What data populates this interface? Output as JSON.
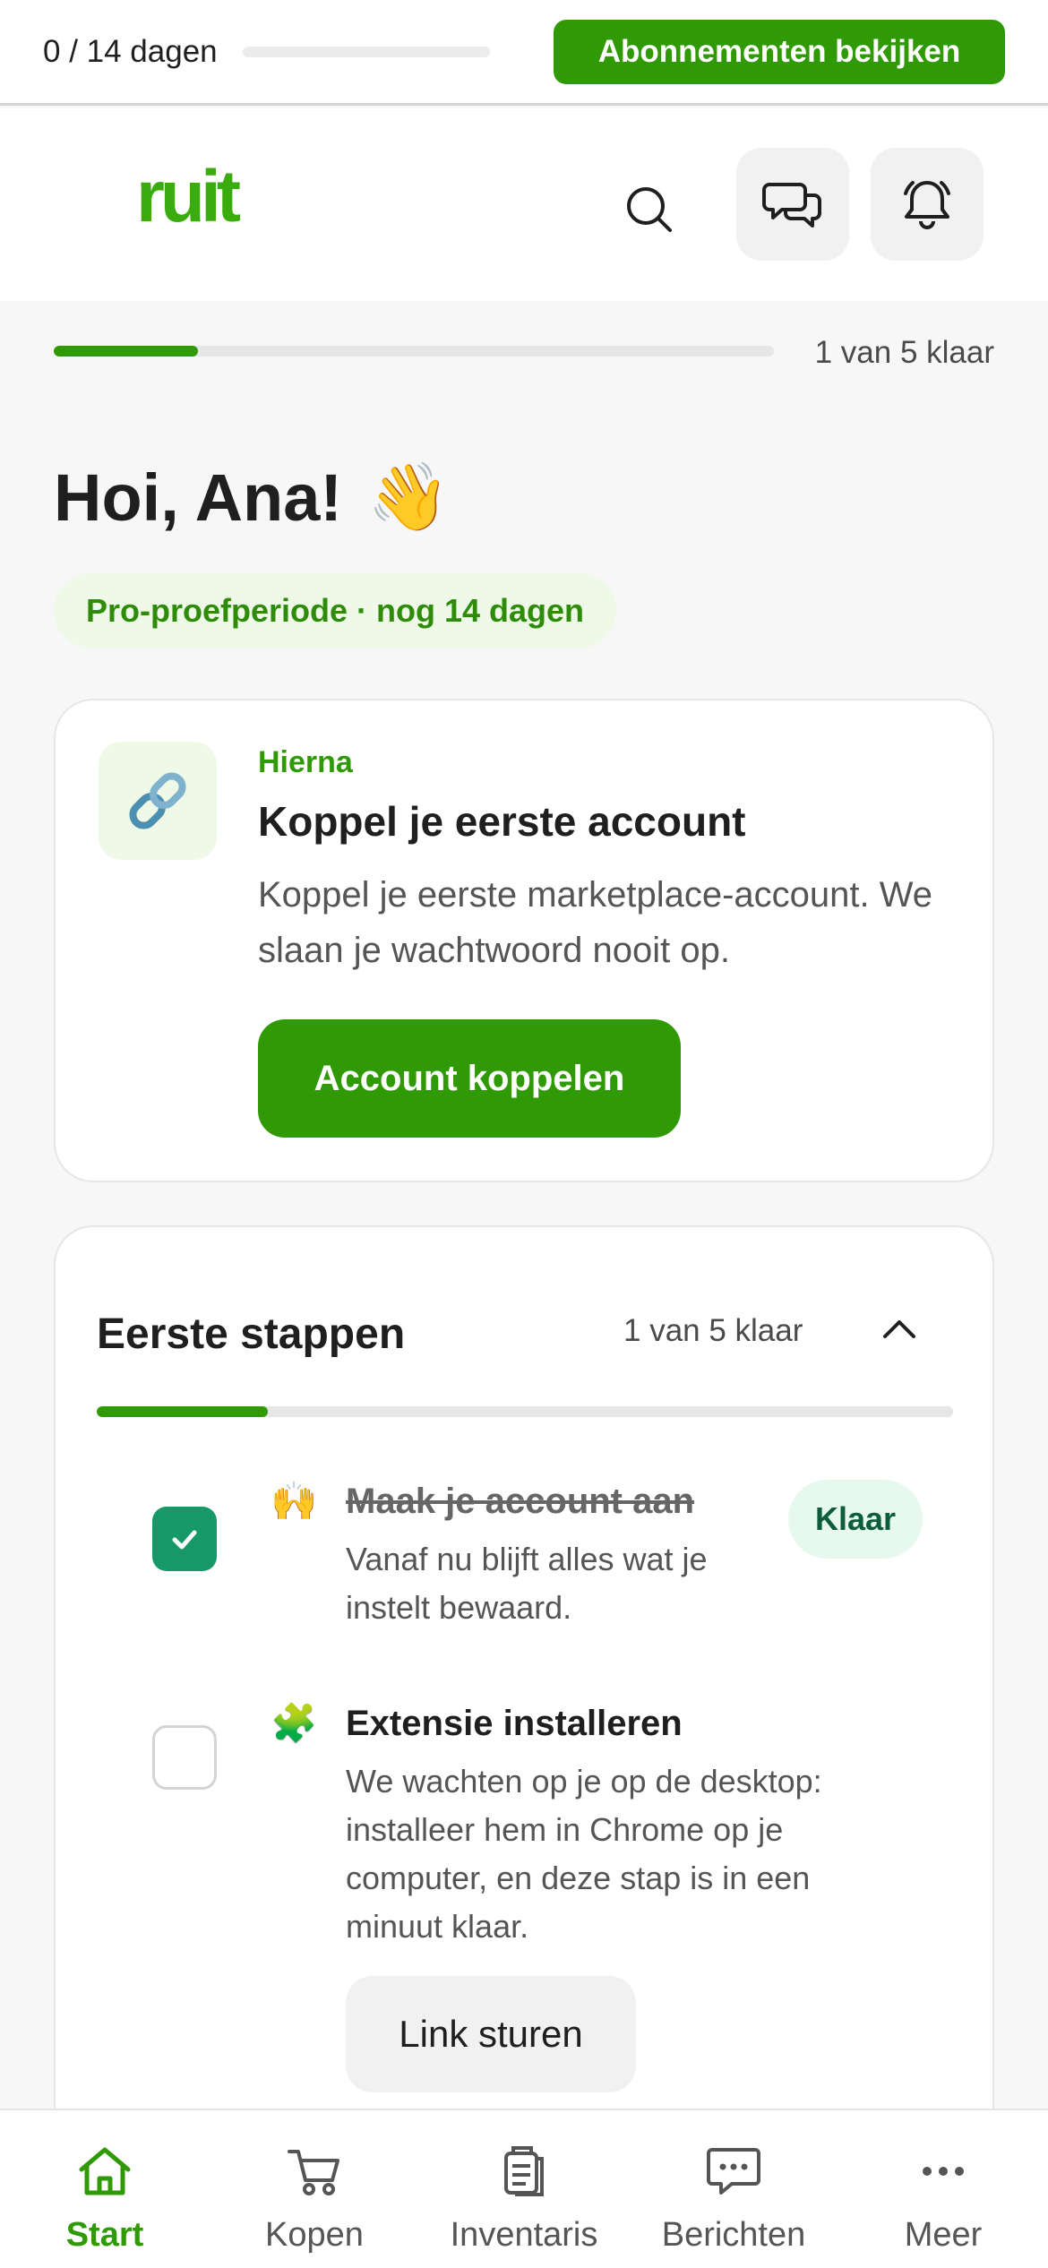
{
  "trial_bar": {
    "count_text": "0 / 14 dagen",
    "progress_fraction": 0,
    "cta_label": "Abonnementen bekijken"
  },
  "header": {
    "logo_text": "ruit",
    "icons": [
      "search-icon",
      "messages-icon",
      "bell-icon"
    ]
  },
  "onboarding": {
    "progress_fraction": 0.2,
    "progress_label": "1 van 5 klaar"
  },
  "greeting": {
    "text": "Hoi, Ana!",
    "emoji": "👋"
  },
  "trial_pill": "Pro-proefperiode · nog 14 dagen",
  "next_card": {
    "icon": "link-icon",
    "eyebrow": "Hierna",
    "title": "Koppel je eerste account",
    "description": "Koppel je eerste marketplace-account. We slaan je wachtwoord nooit op.",
    "cta_label": "Account koppelen"
  },
  "steps": {
    "title": "Eerste stappen",
    "count_label": "1 van 5 klaar",
    "progress_fraction": 0.2,
    "items": [
      {
        "emoji": "🙌",
        "title": "Maak je account aan",
        "description": "Vanaf nu blijft alles wat je instelt bewaard.",
        "done": true,
        "badge": "Klaar"
      },
      {
        "emoji": "🧩",
        "title": "Extensie installeren",
        "description": "We wachten op je op de desktop: installeer hem in Chrome op je computer, en deze stap is in een minuut klaar.",
        "done": false,
        "button_label": "Link sturen"
      }
    ]
  },
  "bottom_nav": {
    "items": [
      {
        "label": "Start",
        "icon": "home-icon",
        "active": true
      },
      {
        "label": "Kopen",
        "icon": "cart-icon",
        "active": false
      },
      {
        "label": "Inventaris",
        "icon": "clipboard-icon",
        "active": false
      },
      {
        "label": "Berichten",
        "icon": "chat-icon",
        "active": false
      },
      {
        "label": "Meer",
        "icon": "more-icon",
        "active": false
      }
    ]
  },
  "colors": {
    "accent": "#2f9a06",
    "logo": "#3aac0d",
    "check_done": "#169868"
  }
}
